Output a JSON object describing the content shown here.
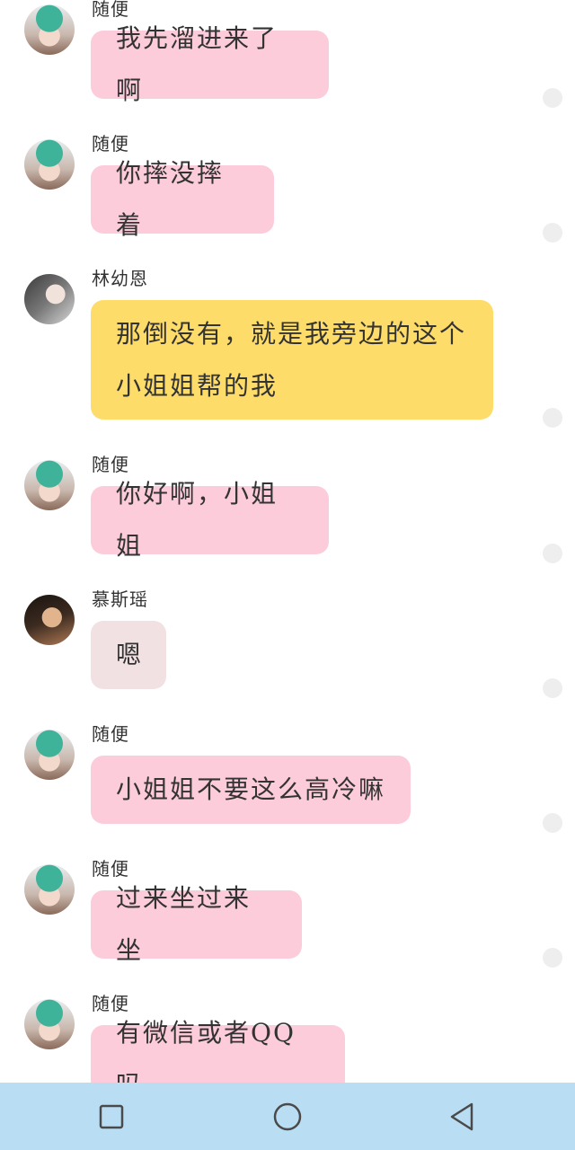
{
  "messages": [
    {
      "sender": "随便",
      "avatar": "suibian",
      "text": "我先溜进来了啊",
      "color": "pink"
    },
    {
      "sender": "随便",
      "avatar": "suibian",
      "text": "你摔没摔着",
      "color": "pink"
    },
    {
      "sender": "林幼恩",
      "avatar": "lin",
      "text": "那倒没有，就是我旁边的这个小姐姐帮的我",
      "color": "yellow"
    },
    {
      "sender": "随便",
      "avatar": "suibian",
      "text": "你好啊，小姐姐",
      "color": "pink"
    },
    {
      "sender": "慕斯瑶",
      "avatar": "mu",
      "text": "嗯",
      "color": "gray"
    },
    {
      "sender": "随便",
      "avatar": "suibian",
      "text": "小姐姐不要这么高冷嘛",
      "color": "pink"
    },
    {
      "sender": "随便",
      "avatar": "suibian",
      "text": "过来坐过来坐",
      "color": "pink"
    },
    {
      "sender": "随便",
      "avatar": "suibian",
      "text": "有微信或者QQ吗",
      "color": "pink"
    }
  ],
  "colors": {
    "pink_bubble": "#fdccdb",
    "yellow_bubble": "#fedc69",
    "gray_bubble": "#f1e1e3",
    "nav_bar": "#b9def4"
  },
  "navbar": {
    "buttons": [
      "recent-apps-icon",
      "home-icon",
      "back-icon"
    ]
  }
}
